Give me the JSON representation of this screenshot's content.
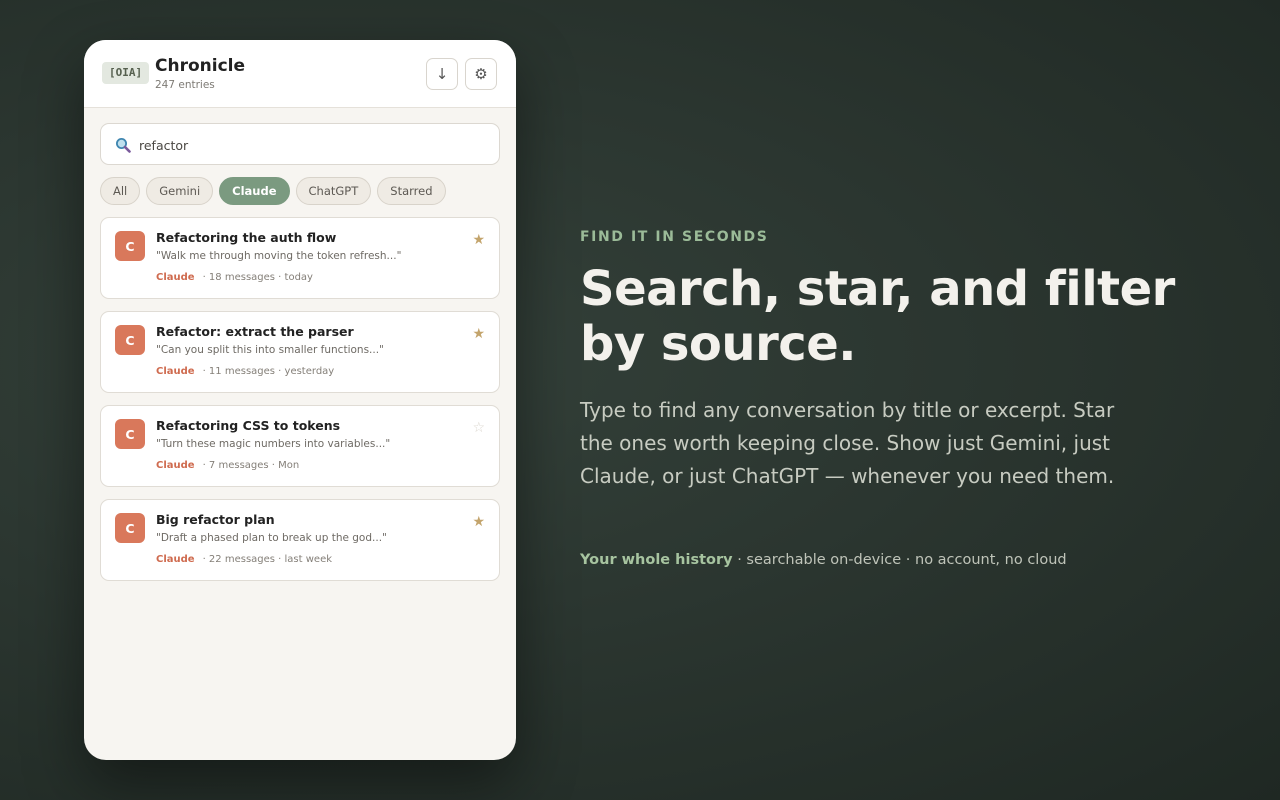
{
  "panel": {
    "badge": "[OIA]",
    "title": "Chronicle",
    "subtitle": "247 entries",
    "download_icon": "↓",
    "settings_icon": "⚙"
  },
  "search": {
    "value": "refactor",
    "icon": "magnifier-icon"
  },
  "filters": [
    {
      "label": "All",
      "active": false
    },
    {
      "label": "Gemini",
      "active": false
    },
    {
      "label": "Claude",
      "active": true
    },
    {
      "label": "ChatGPT",
      "active": false
    },
    {
      "label": "Starred",
      "active": false
    }
  ],
  "conversations": [
    {
      "avatar": "C",
      "title": "Refactoring the auth flow",
      "excerpt": "\"Walk me through moving the token refresh...\"",
      "source": "Claude",
      "meta": "· 18 messages · today",
      "starred": true
    },
    {
      "avatar": "C",
      "title": "Refactor: extract the parser",
      "excerpt": "\"Can you split this into smaller functions...\"",
      "source": "Claude",
      "meta": "· 11 messages · yesterday",
      "starred": true
    },
    {
      "avatar": "C",
      "title": "Refactoring CSS to tokens",
      "excerpt": "\"Turn these magic numbers into variables...\"",
      "source": "Claude",
      "meta": "· 7 messages · Mon",
      "starred": false
    },
    {
      "avatar": "C",
      "title": "Big refactor plan",
      "excerpt": "\"Draft a phased plan to break up the god...\"",
      "source": "Claude",
      "meta": "· 22 messages · last week",
      "starred": true
    }
  ],
  "marketing": {
    "eyebrow": "FIND IT IN SECONDS",
    "headline": "Search, star, and filter by source.",
    "description": "Type to find any conversation by title or excerpt. Star the ones worth keeping close. Show just Gemini, just Claude, or just ChatGPT — whenever you need them.",
    "footer_strong": "Your whole history",
    "footer_rest": " · searchable on-device · no account, no cloud"
  },
  "colors": {
    "accent_green": "#7b9a80",
    "claude_orange": "#d9785b",
    "star_gold": "#c3a46c"
  }
}
